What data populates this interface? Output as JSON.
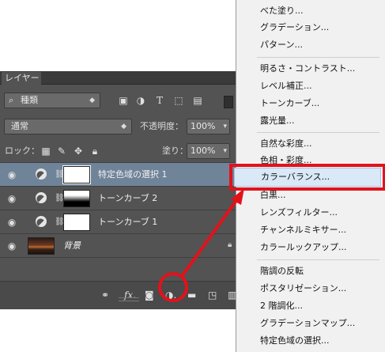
{
  "panel": {
    "tab_label": "レイヤー",
    "filter": {
      "icon": "search-icon",
      "value": "種類"
    },
    "filter_icons": [
      "image-filter-icon",
      "adjustment-filter-icon",
      "text-filter-icon",
      "shape-filter-icon",
      "smart-object-filter-icon"
    ],
    "blend_mode": "通常",
    "opacity_label": "不透明度：",
    "opacity_value": "100%",
    "lock_label": "ロック：",
    "fill_label": "塗り：",
    "fill_value": "100%",
    "layers": [
      {
        "name": "特定色域の選択 1",
        "selected": true,
        "mask": "white"
      },
      {
        "name": "トーンカーブ 2",
        "selected": false,
        "mask": "gradient"
      },
      {
        "name": "トーンカーブ 1",
        "selected": false,
        "mask": "white"
      },
      {
        "name": "背景",
        "selected": false,
        "mask": "none"
      }
    ],
    "footer_icons": [
      "link-icon",
      "fx-icon",
      "add-mask-icon",
      "adjustment-layer-icon",
      "folder-icon",
      "new-layer-icon",
      "trash-icon"
    ]
  },
  "menu": {
    "groups": [
      [
        "べた塗り...",
        "グラデーション...",
        "パターン..."
      ],
      [
        "明るさ・コントラスト...",
        "レベル補正...",
        "トーンカーブ...",
        "露光量..."
      ],
      [
        "自然な彩度...",
        "色相・彩度...",
        "カラーバランス...",
        "白黒...",
        "レンズフィルター...",
        "チャンネルミキサー...",
        "カラールックアップ..."
      ],
      [
        "階調の反転",
        "ポスタリゼーション...",
        "2 階調化...",
        "グラデーションマップ...",
        "特定色域の選択..."
      ]
    ],
    "highlighted": "カラーバランス..."
  },
  "annotation": {
    "color": "#e2121b"
  }
}
